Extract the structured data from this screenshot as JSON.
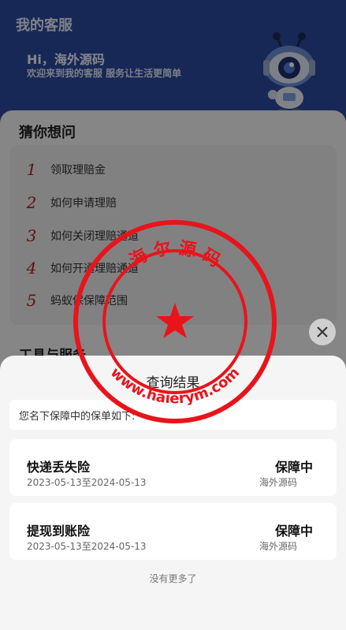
{
  "header": {
    "title": "我的客服",
    "greeting": "Hi，海外源码",
    "subtitle": "欢迎来到我的客服 服务让生活更简单"
  },
  "faq": {
    "title": "猜你想问",
    "items": [
      {
        "num": "1",
        "label": "领取理赔金"
      },
      {
        "num": "2",
        "label": "如何申请理赔"
      },
      {
        "num": "3",
        "label": "如何关闭理赔通道"
      },
      {
        "num": "4",
        "label": "如何开通理赔通道"
      },
      {
        "num": "5",
        "label": "蚂蚁保保障范围"
      }
    ]
  },
  "tools": {
    "title": "工具与服务"
  },
  "sheet": {
    "title": "查询结果",
    "notice": "您名下保障中的保单如下:",
    "policies": [
      {
        "name": "快递丢失险",
        "period": "2023-05-13至2024-05-13",
        "status": "保障中",
        "issuer": "海外源码"
      },
      {
        "name": "提现到账险",
        "period": "2023-05-13至2024-05-13",
        "status": "保障中",
        "issuer": "海外源码"
      }
    ],
    "footer": "没有更多了"
  },
  "stamp": {
    "top_text": "海 尔 源 码",
    "bottom_text": "www.haierym.com",
    "color": "#e8141b"
  },
  "colors": {
    "hero_bg": "#2b4a9e",
    "faq_number": "#b02020"
  },
  "icons": {
    "close": "close-icon",
    "mascot": "robot-mascot",
    "stamp_center": "star-icon"
  }
}
